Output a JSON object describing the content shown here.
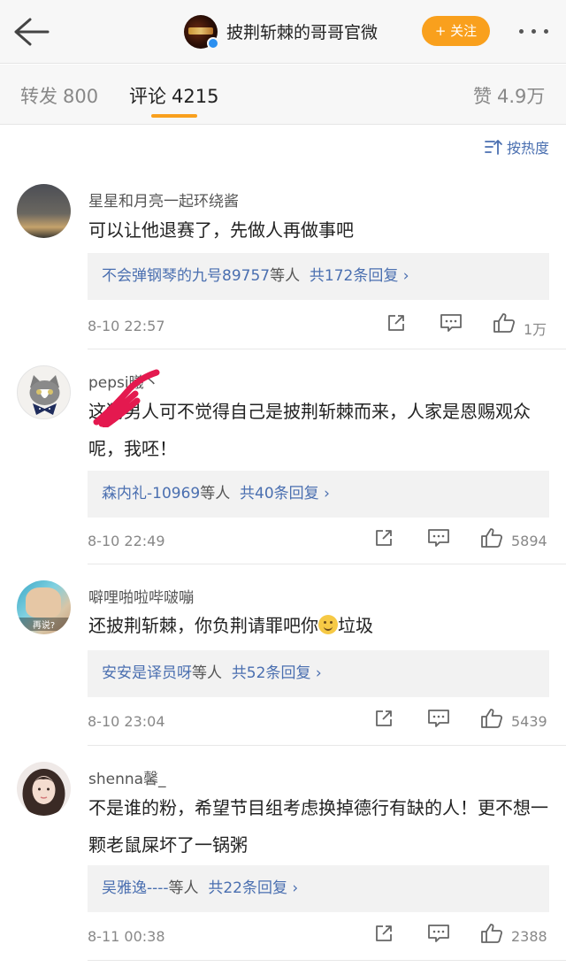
{
  "header": {
    "account_name": "披荆斩棘的哥哥官微",
    "follow_label": "+ 关注"
  },
  "tabs": [
    {
      "label": "转发",
      "value": "800"
    },
    {
      "label": "评论",
      "value": "4215"
    },
    {
      "label": "赞",
      "value": "4.9万"
    }
  ],
  "sort_label": "按热度",
  "colors": {
    "accent": "#f9a01d",
    "link": "#4a6fb0"
  },
  "comments": [
    {
      "username": "星星和月亮一起环绕酱",
      "text": "可以让他退赛了，先做人再做事吧",
      "reply_names": "不会弹钢琴的九号89757",
      "reply_mid": "等人",
      "reply_count": "共172条回复 ›",
      "time": "8-10 22:57",
      "likes": "1万"
    },
    {
      "username": "pepsi曦丶",
      "text": "这狗男人可不觉得自己是披荆斩棘而来，人家是恩赐观众呢，我呸！",
      "reply_names": "森内礼-10969",
      "reply_mid": "等人",
      "reply_count": "共40条回复 ›",
      "time": "8-10 22:49",
      "likes": "5894"
    },
    {
      "username": "噼哩啪啦哔啵嘣",
      "avatar_text": "再说?",
      "text_a": "还披荆斩棘，你负荆请罪吧你",
      "text_b": "垃圾",
      "reply_names": "安安是译员呀",
      "reply_mid": "等人",
      "reply_count": "共52条回复 ›",
      "time": "8-10 23:04",
      "likes": "5439"
    },
    {
      "username": "shenna馨_",
      "text": "不是谁的粉，希望节目组考虑换掉德行有缺的人！更不想一颗老鼠屎坏了一锅粥",
      "reply_names": "吴雅逸----",
      "reply_mid": "等人",
      "reply_count": "共22条回复 ›",
      "time": "8-11 00:38",
      "likes": "2388"
    }
  ]
}
